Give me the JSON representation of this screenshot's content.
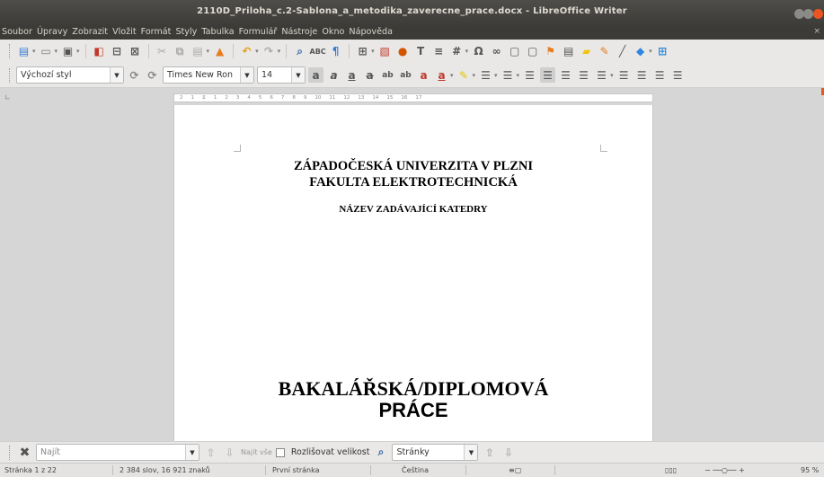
{
  "window": {
    "title": "2110D_Priloha_c.2-Sablona_a_metodika_zaverecne_prace.docx - LibreOffice Writer"
  },
  "menu": [
    "Soubor",
    "Úpravy",
    "Zobrazit",
    "Vložit",
    "Formát",
    "Styly",
    "Tabulka",
    "Formulář",
    "Nástroje",
    "Okno",
    "Nápověda"
  ],
  "formatting": {
    "paragraph_style": "Výchozí styl",
    "font_name": "Times New Ron",
    "font_size": "14"
  },
  "document": {
    "line1": "ZÁPADOČESKÁ UNIVERZITA V PLZNI",
    "line2": "FAKULTA ELEKTROTECHNICKÁ",
    "line3": "NÁZEV ZADÁVAJÍCÍ KATEDRY",
    "line4": "BAKALÁŘSKÁ/DIPLOMOVÁ",
    "line5": "PRÁCE"
  },
  "ruler": {
    "ticks": [
      "2",
      "1",
      "1",
      "2",
      "3",
      "4",
      "5",
      "6",
      "7",
      "8",
      "9",
      "10",
      "11",
      "12",
      "13",
      "14",
      "15",
      "16",
      "17"
    ]
  },
  "find": {
    "placeholder": "Najít",
    "find_all": "Najít vše",
    "match_case": "Rozlišovat velikost",
    "search_by": "Stránky"
  },
  "status": {
    "page": "Stránka 1 z 22",
    "words": "2 384 slov, 16 921 znaků",
    "page_style": "První stránka",
    "language": "Čeština",
    "zoom": "95 %"
  },
  "colors": {
    "accent": "#e95420",
    "title_bg": "#3c3b37"
  }
}
